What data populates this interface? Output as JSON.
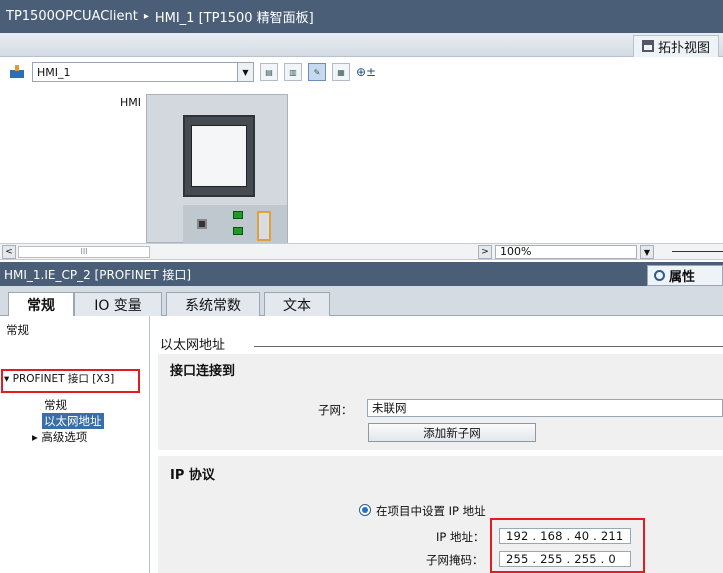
{
  "title_bar": {
    "project": "TP1500OPCUAClient",
    "separator": "▸",
    "device": "HMI_1 [TP1500 精智面板]"
  },
  "view_bar": {
    "topology_label": "拓扑视图",
    "topology_icon": "topology-icon"
  },
  "toolbar": {
    "device_select_value": "HMI_1",
    "zoom_icon": "zoom-in-icon"
  },
  "canvas": {
    "device_label": "HMI"
  },
  "hscroll": {
    "left_arrow": "<",
    "thumb_grip": "III",
    "right_arrow": ">",
    "zoom_value": "100%",
    "zoom_dd": "▼"
  },
  "inspector": {
    "header_title": "HMI_1.IE_CP_2 [PROFINET 接口]",
    "properties_tab": "属性",
    "tabs": [
      {
        "label": "常规"
      },
      {
        "label": "IO 变量"
      },
      {
        "label": "系统常数"
      },
      {
        "label": "文本"
      }
    ],
    "sidebar": {
      "general": "常规",
      "profinet_interface": "▾ PROFINET 接口 [X3]",
      "sub_general": "常规",
      "ethernet_addresses": "以太网地址",
      "advanced_options": "▸ 高级选项"
    },
    "content": {
      "section_title": "以太网地址",
      "interface_connected_head": "接口连接到",
      "subnet_label": "子网：",
      "subnet_value": "未联网",
      "add_subnet_button": "添加新子网",
      "ip_protocol_head": "IP 协议",
      "set_ip_option": "在项目中设置 IP 地址",
      "ip_label": "IP 地址：",
      "ip_value": "192 . 168 . 40 . 211",
      "mask_label": "子网掩码：",
      "mask_value": "255 . 255 . 255 . 0"
    }
  },
  "colors": {
    "header_bg": "#4a5f77",
    "highlight": "#e31b23",
    "selection": "#3b6ea8"
  }
}
